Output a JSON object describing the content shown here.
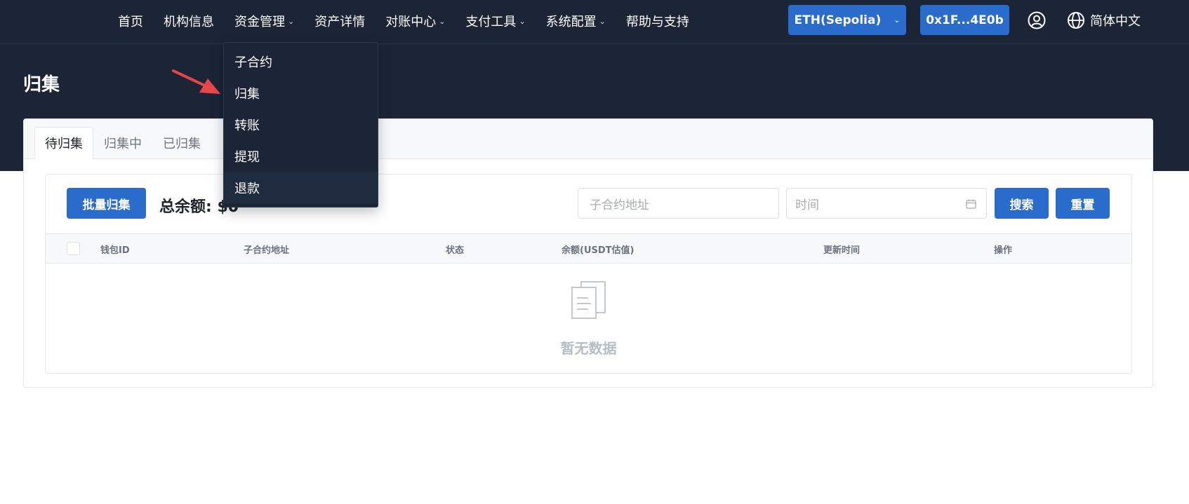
{
  "nav": {
    "items": [
      {
        "label": "首页",
        "has_dropdown": false
      },
      {
        "label": "机构信息",
        "has_dropdown": false
      },
      {
        "label": "资金管理",
        "has_dropdown": true
      },
      {
        "label": "资产详情",
        "has_dropdown": false
      },
      {
        "label": "对账中心",
        "has_dropdown": true
      },
      {
        "label": "支付工具",
        "has_dropdown": true
      },
      {
        "label": "系统配置",
        "has_dropdown": true
      },
      {
        "label": "帮助与支持",
        "has_dropdown": false
      }
    ],
    "network_label": "ETH(Sepolia)",
    "wallet_label": "0x1F...4E0b",
    "language_label": "简体中文",
    "chevron": "⌄"
  },
  "page": {
    "title": "归集"
  },
  "dropdown": {
    "items": [
      "子合约",
      "归集",
      "转账",
      "提现",
      "退款"
    ],
    "hovered_index": 4
  },
  "tabs": [
    "待归集",
    "归集中",
    "已归集"
  ],
  "active_tab": 0,
  "toolbar": {
    "batch_label": "批量归集",
    "total_label": "总余额: $0",
    "address_placeholder": "子合约地址",
    "time_placeholder": "时间",
    "search_label": "搜索",
    "reset_label": "重置"
  },
  "table": {
    "columns": [
      "钱包ID",
      "子合约地址",
      "状态",
      "余额(USDT估值)",
      "更新时间",
      "操作"
    ],
    "rows": [],
    "empty_text": "暂无数据"
  },
  "colors": {
    "nav_bg": "#1b2536",
    "primary": "#2a6ccb",
    "annotation_arrow": "#e8474a"
  }
}
